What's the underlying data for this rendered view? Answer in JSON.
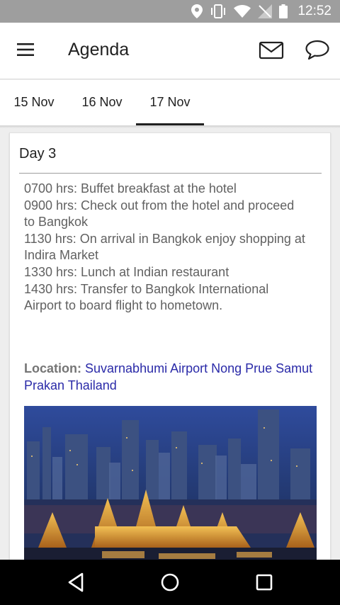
{
  "status_bar": {
    "time": "12:52",
    "icons": [
      "location-icon",
      "vibrate-icon",
      "wifi-icon",
      "no-signal-icon",
      "battery-icon"
    ]
  },
  "app_bar": {
    "title": "Agenda",
    "icons": [
      "menu-icon",
      "mail-icon",
      "chat-icon"
    ]
  },
  "tabs": [
    {
      "label": "15 Nov",
      "selected": false
    },
    {
      "label": "16 Nov",
      "selected": false
    },
    {
      "label": "17 Nov",
      "selected": true
    }
  ],
  "card": {
    "day_title": "Day 3",
    "schedule": [
      "0700 hrs: Buffet breakfast at the hotel",
      "0900 hrs: Check out from the hotel and proceed to Bangkok",
      "1130 hrs: On arrival in Bangkok enjoy shopping at Indira Market",
      "1330 hrs: Lunch at Indian restaurant",
      "1430 hrs: Transfer to Bangkok International Airport to board flight to hometown."
    ],
    "location_label": "Location:",
    "location_value": "Suvarnabhumi Airport Nong Prue Samut Prakan Thailand",
    "photo": "bangkok-grand-palace-night-photo"
  },
  "nav_bar": {
    "icons": [
      "back-icon",
      "home-icon",
      "recents-icon"
    ]
  },
  "colors": {
    "status_bar": "#9e9e9e",
    "tab_indicator": "#212121",
    "location_link": "#2a2aa8",
    "nav_bar": "#000000"
  }
}
